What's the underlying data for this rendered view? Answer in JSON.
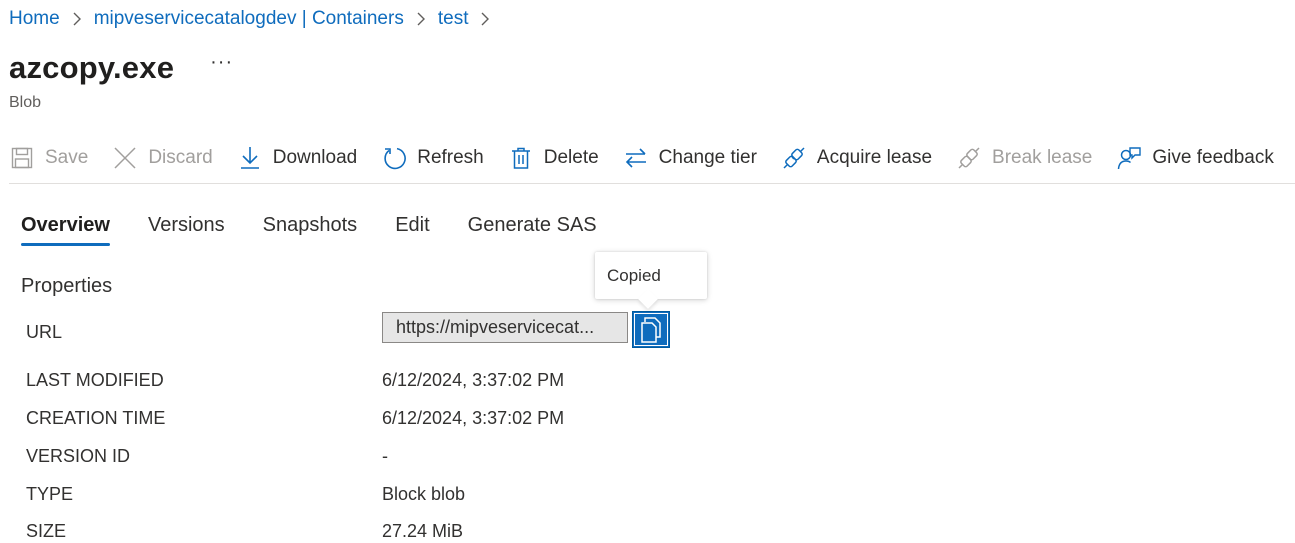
{
  "breadcrumb": {
    "items": [
      "Home",
      "mipveservicecatalogdev | Containers",
      "test"
    ]
  },
  "header": {
    "title": "azcopy.exe",
    "more": "···",
    "subtitle": "Blob"
  },
  "toolbar": {
    "save": "Save",
    "discard": "Discard",
    "download": "Download",
    "refresh": "Refresh",
    "delete": "Delete",
    "change_tier": "Change tier",
    "acquire_lease": "Acquire lease",
    "break_lease": "Break lease",
    "give_feedback": "Give feedback"
  },
  "tabs": [
    "Overview",
    "Versions",
    "Snapshots",
    "Edit",
    "Generate SAS"
  ],
  "active_tab": "Overview",
  "properties": {
    "section_title": "Properties",
    "url_label": "URL",
    "url_value": "https://mipveservicecat...",
    "tooltip": "Copied",
    "rows": [
      {
        "label": "LAST MODIFIED",
        "value": "6/12/2024, 3:37:02 PM"
      },
      {
        "label": "CREATION TIME",
        "value": "6/12/2024, 3:37:02 PM"
      },
      {
        "label": "VERSION ID",
        "value": "-"
      },
      {
        "label": "TYPE",
        "value": "Block blob"
      },
      {
        "label": "SIZE",
        "value": "27.24 MiB"
      }
    ]
  },
  "colors": {
    "accent": "#0f6cbd",
    "disabled": "#a19f9d"
  }
}
